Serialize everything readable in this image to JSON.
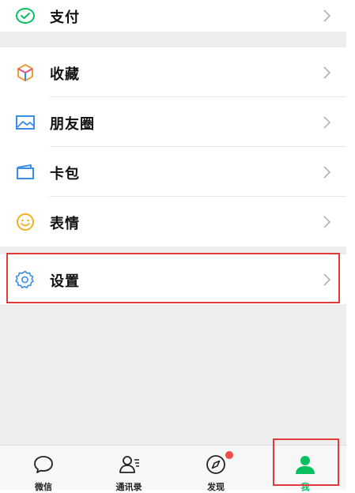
{
  "colors": {
    "accent": "#07c160",
    "highlight": "#e03a3a",
    "badge": "#f04a4a"
  },
  "menu": {
    "pay": {
      "label": "支付",
      "icon": "wechat-pay-icon"
    },
    "favorites": {
      "label": "收藏",
      "icon": "cube-icon"
    },
    "moments": {
      "label": "朋友圈",
      "icon": "image-icon"
    },
    "cards": {
      "label": "卡包",
      "icon": "card-wallet-icon"
    },
    "stickers": {
      "label": "表情",
      "icon": "smiley-icon"
    },
    "settings": {
      "label": "设置",
      "icon": "gear-icon"
    }
  },
  "tabbar": {
    "tabs": [
      {
        "label": "微信",
        "icon": "chat-bubble-icon"
      },
      {
        "label": "通讯录",
        "icon": "contacts-icon"
      },
      {
        "label": "发现",
        "icon": "compass-icon",
        "badge": true
      },
      {
        "label": "我",
        "icon": "person-icon",
        "active": true
      }
    ]
  }
}
